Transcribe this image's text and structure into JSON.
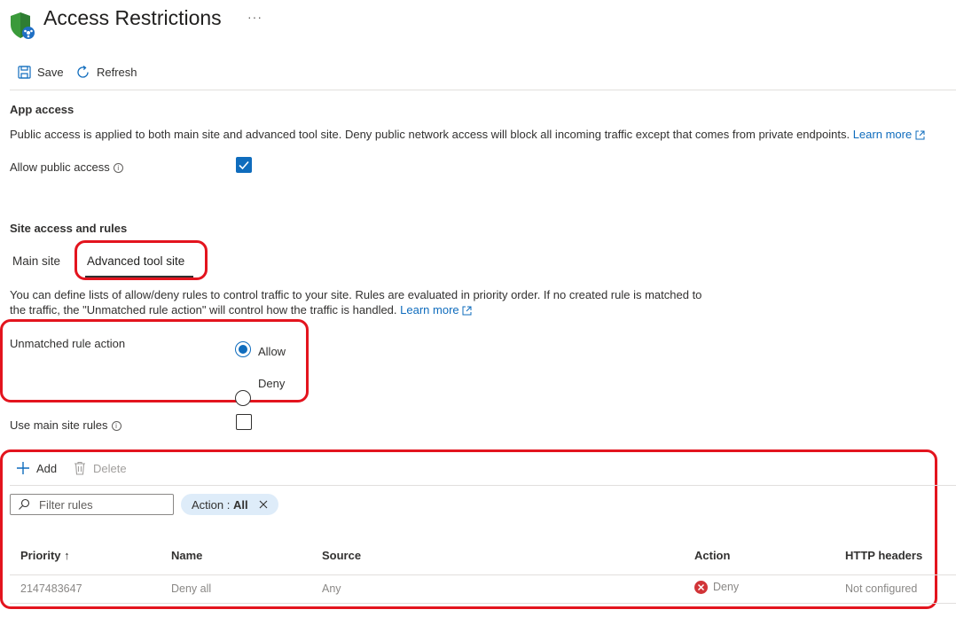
{
  "header": {
    "title": "Access Restrictions",
    "more": "···"
  },
  "toolbar": {
    "save_label": "Save",
    "refresh_label": "Refresh"
  },
  "app_access": {
    "heading": "App access",
    "description": "Public access is applied to both main site and advanced tool site. Deny public network access will block all incoming traffic except that comes from private endpoints.",
    "learn_more": "Learn more",
    "allow_public_access_label": "Allow public access",
    "allow_public_access_checked": true
  },
  "site_access": {
    "heading": "Site access and rules",
    "tabs": [
      {
        "label": "Main site",
        "selected": false
      },
      {
        "label": "Advanced tool site",
        "selected": true
      }
    ],
    "description_line1": "You can define lists of allow/deny rules to control traffic to your site. Rules are evaluated in priority order. If no created rule is matched to",
    "description_line2": "the traffic, the \"Unmatched rule action\" will control how the traffic is handled.",
    "learn_more": "Learn more",
    "unmatched_rule_action_label": "Unmatched rule action",
    "options": [
      {
        "label": "Allow",
        "selected": true
      },
      {
        "label": "Deny",
        "selected": false
      }
    ],
    "use_main_site_rules_label": "Use main site rules",
    "use_main_site_rules_checked": false
  },
  "rules_toolbar": {
    "add_label": "Add",
    "delete_label": "Delete"
  },
  "filter": {
    "placeholder": "Filter rules",
    "pill_prefix": "Action : ",
    "pill_value": "All"
  },
  "table": {
    "columns": [
      "Priority ↑",
      "Name",
      "Source",
      "Action",
      "HTTP headers"
    ],
    "rows": [
      {
        "priority": "2147483647",
        "name": "Deny all",
        "source": "Any",
        "action": "Deny",
        "http_headers": "Not configured"
      }
    ]
  },
  "colors": {
    "accent": "#0f6cbd",
    "highlight": "#e3141e",
    "deny": "#d13438"
  }
}
